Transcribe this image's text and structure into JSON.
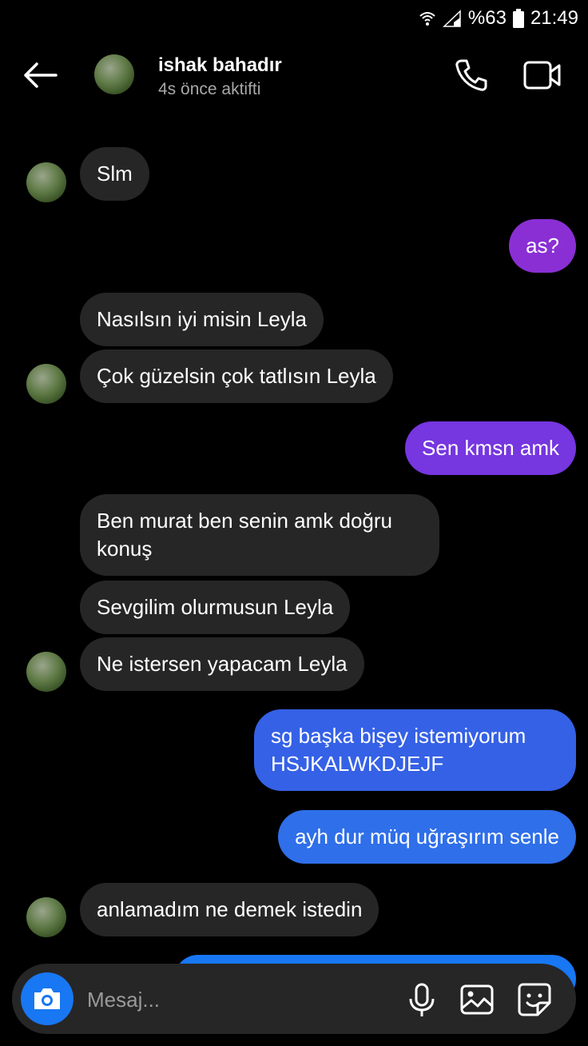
{
  "status_bar": {
    "battery": "%63",
    "time": "21:49"
  },
  "header": {
    "contact_name": "ishak bahadır",
    "contact_status": "4s önce aktifti",
    "icons": [
      "back-arrow-icon",
      "phone-icon",
      "video-camera-icon"
    ]
  },
  "messages": [
    {
      "side": "in",
      "text": "Slm"
    },
    {
      "side": "out",
      "text": "as?",
      "color": "#8a2fd4"
    },
    {
      "side": "in",
      "text": "Nasılsın iyi misin Leyla"
    },
    {
      "side": "in",
      "text": "Çok güzelsin çok tatlısın Leyla"
    },
    {
      "side": "out",
      "text": "Sen kmsn amk",
      "color": "#7636e0"
    },
    {
      "side": "in",
      "text": "Ben murat ben senin amk doğru konuş"
    },
    {
      "side": "in",
      "text": "Sevgilim olurmusun Leyla"
    },
    {
      "side": "in",
      "text": "Ne istersen yapacam Leyla"
    },
    {
      "side": "out",
      "text": "sg başka bişey istemiyorum HSJKALWKDJEJF",
      "color": "#3561e6"
    },
    {
      "side": "out",
      "text": "ayh dur müq uğraşırım senle",
      "color": "#2f6fe9"
    },
    {
      "side": "in",
      "text": "anlamadım ne demek istedin"
    }
  ],
  "composer": {
    "placeholder": "Mesaj...",
    "icons": [
      "camera-icon",
      "microphone-icon",
      "gallery-icon",
      "sticker-icon"
    ],
    "accent": "#1877f2"
  }
}
